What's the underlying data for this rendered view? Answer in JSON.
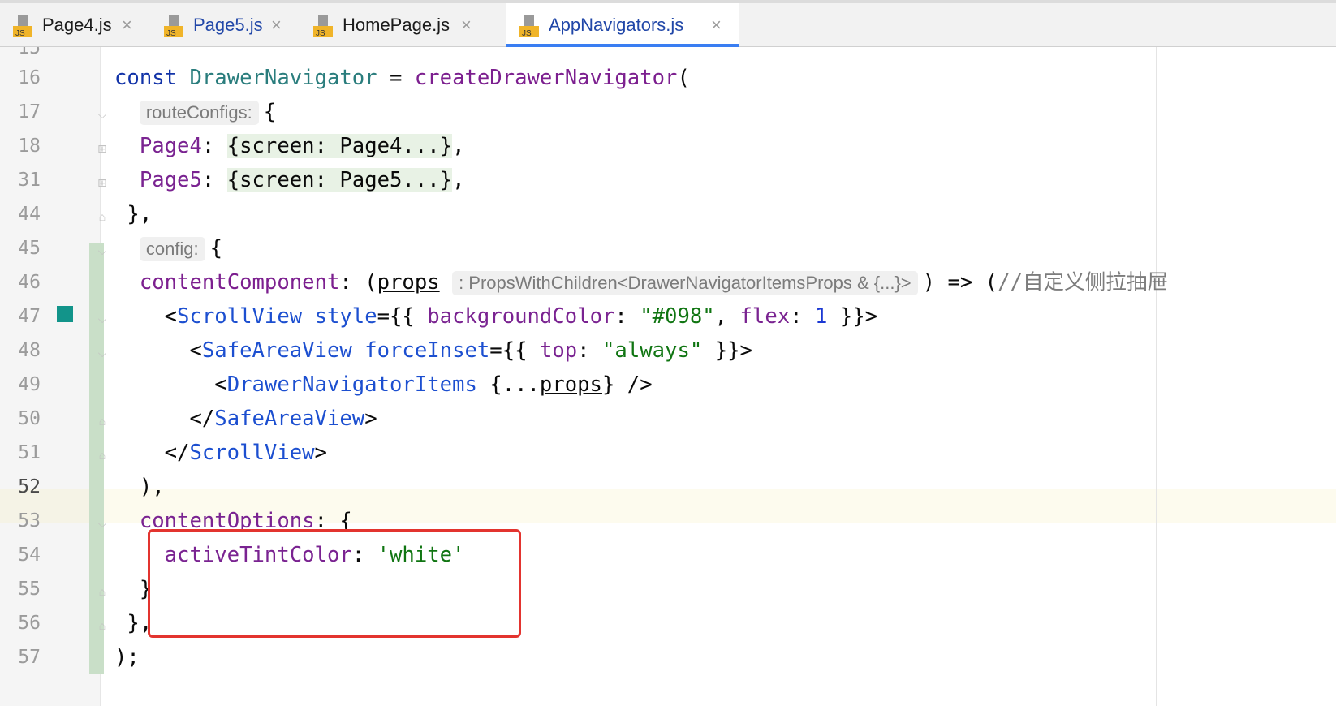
{
  "tabs": [
    {
      "label": "Page4.js",
      "icon": "js-file-icon",
      "active": false
    },
    {
      "label": "Page5.js",
      "icon": "js-file-icon",
      "active": false
    },
    {
      "label": "HomePage.js",
      "icon": "js-file-icon",
      "active": false
    },
    {
      "label": "AppNavigators.js",
      "icon": "js-file-icon",
      "active": true
    }
  ],
  "close_glyph": "×",
  "file_icon_text": "JS",
  "editor": {
    "partial_line_number": "15",
    "current_line": "52",
    "lines": [
      {
        "n": "16"
      },
      {
        "n": "17"
      },
      {
        "n": "18"
      },
      {
        "n": "31"
      },
      {
        "n": "44"
      },
      {
        "n": "45"
      },
      {
        "n": "46"
      },
      {
        "n": "47"
      },
      {
        "n": "48"
      },
      {
        "n": "49"
      },
      {
        "n": "50"
      },
      {
        "n": "51"
      },
      {
        "n": "52"
      },
      {
        "n": "53"
      },
      {
        "n": "54"
      },
      {
        "n": "55"
      },
      {
        "n": "56"
      },
      {
        "n": "57"
      }
    ],
    "hints": {
      "routeConfigs": "routeConfigs:",
      "config": "config:",
      "props_type": ": PropsWithChildren<DrawerNavigatorItemsProps & {...}>"
    },
    "comment": "//自定义侧拉抽屉",
    "annotation": "contentOptions highlighted",
    "colors": {
      "highlight_box": "#e3342f",
      "active_tab_underline": "#3a7ef2"
    }
  }
}
